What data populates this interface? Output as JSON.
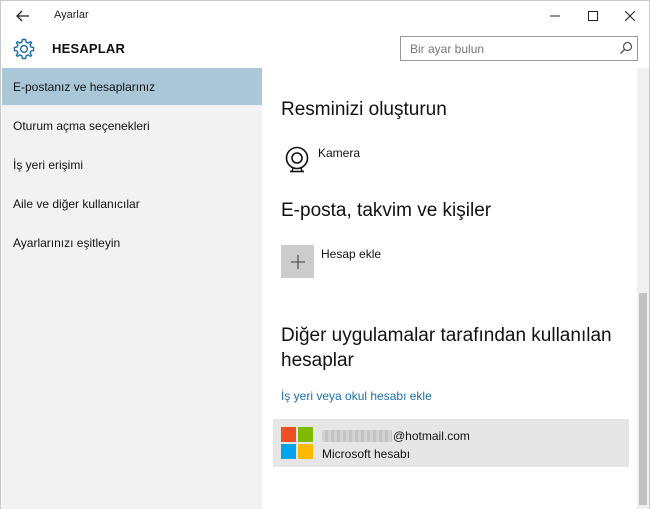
{
  "window": {
    "title": "Ayarlar",
    "section_title": "HESAPLAR"
  },
  "search": {
    "placeholder": "Bir ayar bulun"
  },
  "sidebar": {
    "items": [
      {
        "label": "E-postanız ve hesaplarınız",
        "selected": true
      },
      {
        "label": "Oturum açma seçenekleri",
        "selected": false
      },
      {
        "label": "İş yeri erişimi",
        "selected": false
      },
      {
        "label": "Aile ve diğer kullanıcılar",
        "selected": false
      },
      {
        "label": "Ayarlarınızı eşitleyin",
        "selected": false
      }
    ]
  },
  "content": {
    "picture_heading": "Resminizi oluşturun",
    "camera_label": "Kamera",
    "email_heading": "E-posta, takvim ve kişiler",
    "add_account_label": "Hesap ekle",
    "other_apps_heading_line1": "Diğer uygulamalar tarafından kullanılan",
    "other_apps_heading_line2": "hesaplar",
    "add_work_link": "İş yeri veya okul hesabı ekle",
    "account": {
      "email_suffix": "@hotmail.com",
      "type": "Microsoft hesabı"
    }
  },
  "icons": {
    "back": "back-arrow-icon",
    "minimize": "minimize-icon",
    "maximize": "maximize-icon",
    "close": "close-icon",
    "settings": "gear-icon",
    "search": "search-icon",
    "camera": "camera-icon",
    "add": "plus-icon",
    "account_logo": "microsoft-logo-icon"
  },
  "colors": {
    "selected_nav": "#a9c7d6",
    "link": "#1a6fa8",
    "accent_gear": "#1a6fa8",
    "ms_red": "#f25022",
    "ms_green": "#7fba00",
    "ms_blue": "#00a4ef",
    "ms_yellow": "#ffb900"
  }
}
